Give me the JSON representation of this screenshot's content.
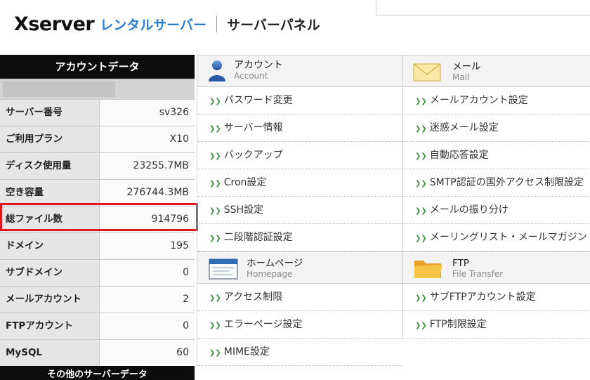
{
  "logo": {
    "brand": "Xserver",
    "product": "レンタルサーバー",
    "panel": "サーバーパネル"
  },
  "account": {
    "header": "アカウントデータ",
    "rows": [
      {
        "label": "サーバー番号",
        "value": "sv326"
      },
      {
        "label": "ご利用プラン",
        "value": "X10"
      },
      {
        "label": "ディスク使用量",
        "value": "23255.7MB"
      },
      {
        "label": "空き容量",
        "value": "276744.3MB"
      },
      {
        "label": "総ファイル数",
        "value": "914796"
      },
      {
        "label": "ドメイン",
        "value": "195"
      },
      {
        "label": "サブドメイン",
        "value": "0"
      },
      {
        "label": "メールアカウント",
        "value": "2"
      },
      {
        "label": "FTPアカウント",
        "value": "0"
      },
      {
        "label": "MySQL",
        "value": "60"
      }
    ],
    "footer": "その他のサーバーデータ"
  },
  "sections": {
    "account": {
      "title": "アカウント",
      "subtitle": "Account",
      "items": [
        "パスワード変更",
        "サーバー情報",
        "バックアップ",
        "Cron設定",
        "SSH設定",
        "二段階認証設定"
      ]
    },
    "mail": {
      "title": "メール",
      "subtitle": "Mail",
      "items": [
        "メールアカウント設定",
        "迷惑メール設定",
        "自動応答設定",
        "SMTP認証の国外アクセス制限設定",
        "メールの振り分け",
        "メーリングリスト・メールマガジン"
      ]
    },
    "homepage": {
      "title": "ホームページ",
      "subtitle": "Homepage",
      "items": [
        "アクセス制限",
        "エラーページ設定",
        "MIME設定"
      ]
    },
    "ftp": {
      "title": "FTP",
      "subtitle": "File Transfer",
      "items": [
        "サブFTPアカウント設定",
        "FTP制限設定"
      ]
    }
  },
  "icons": {
    "account": "user-icon",
    "mail": "envelope-icon",
    "homepage": "browser-window-icon",
    "ftp": "folder-icon",
    "link_arrow": "double-chevron-icon"
  },
  "colors": {
    "highlight": "#e0161d",
    "brand_blue": "#2a7fd3",
    "link_arrow": "#3d8f3d"
  }
}
